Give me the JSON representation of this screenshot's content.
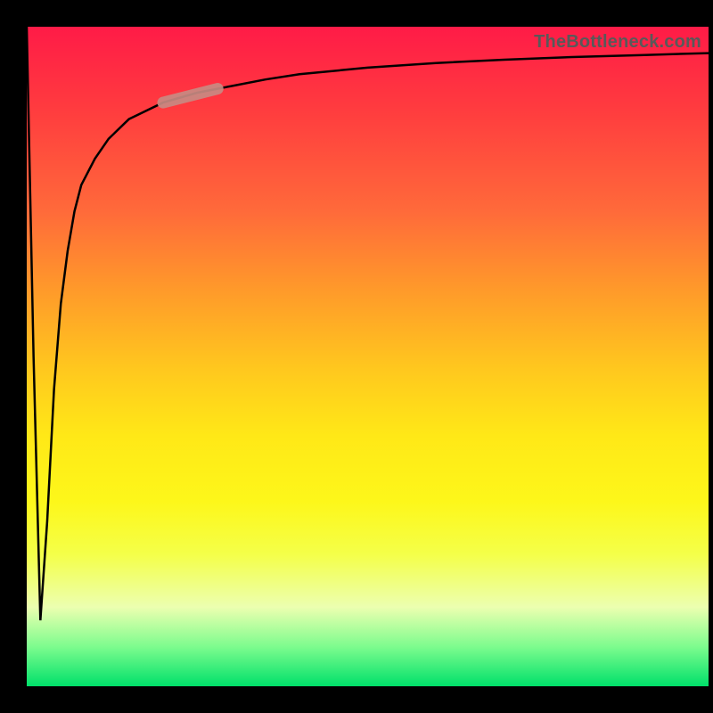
{
  "attribution": "TheBottleneck.com",
  "colors": {
    "frame": "#000000",
    "gradient_top": "#ff1b47",
    "gradient_mid": "#ffe817",
    "gradient_bottom": "#00e06a",
    "curve": "#000000",
    "highlight": "#c88a82"
  },
  "chart_data": {
    "type": "line",
    "title": "",
    "xlabel": "",
    "ylabel": "",
    "xlim": [
      0,
      100
    ],
    "ylim": [
      0,
      100
    ],
    "grid": false,
    "series": [
      {
        "name": "curve",
        "x": [
          0,
          1,
          2,
          3,
          4,
          5,
          6,
          7,
          8,
          10,
          12,
          15,
          20,
          25,
          30,
          35,
          40,
          50,
          60,
          70,
          80,
          90,
          100
        ],
        "values": [
          100,
          50,
          10,
          25,
          45,
          58,
          66,
          72,
          76,
          80,
          83,
          86,
          88.5,
          90,
          91,
          92,
          92.8,
          93.8,
          94.5,
          95,
          95.4,
          95.7,
          96
        ]
      }
    ],
    "highlight_segment": {
      "x_start": 20,
      "x_end": 28
    },
    "annotations": []
  }
}
